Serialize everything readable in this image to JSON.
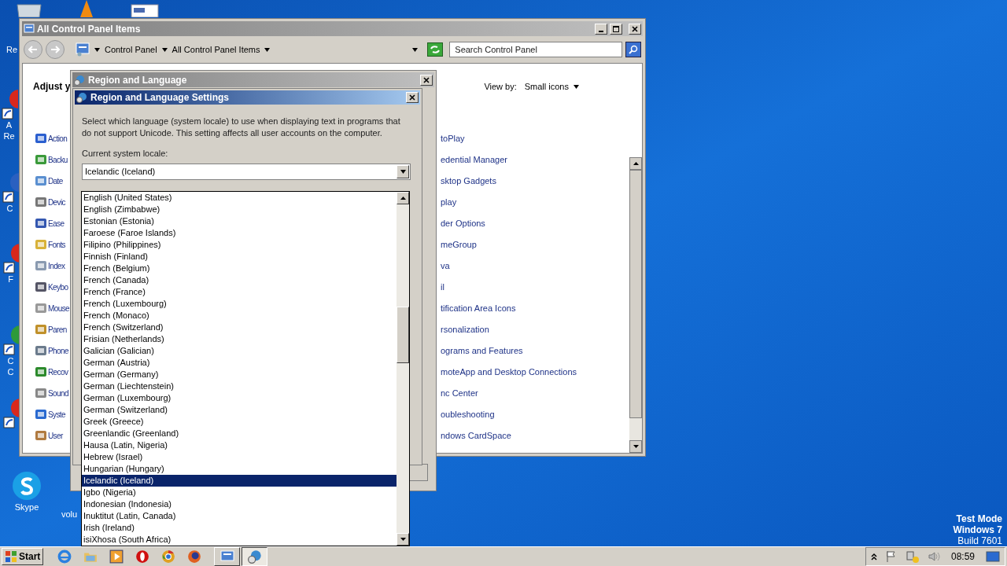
{
  "desktop": {
    "icons": [
      {
        "kind": "bin",
        "lines": [
          "Re"
        ]
      },
      {
        "kind": "cone"
      },
      {
        "kind": "doc"
      },
      {
        "kind": "red",
        "lines": [
          "A",
          "Re"
        ]
      },
      {
        "kind": "blue",
        "lines": [
          "C"
        ]
      },
      {
        "kind": "red",
        "lines": [
          "F"
        ]
      },
      {
        "kind": "green",
        "lines": [
          "C",
          "C"
        ]
      },
      {
        "kind": "red"
      },
      {
        "kind": "skype",
        "lines": [
          "Skype"
        ]
      },
      {
        "kind": "blank",
        "lines": [
          "volu"
        ]
      }
    ],
    "notice": [
      "Test Mode",
      "Windows 7",
      "Build 7601"
    ]
  },
  "control_panel": {
    "title": "All Control Panel Items",
    "breadcrumbs": [
      "Control Panel",
      "All Control Panel Items"
    ],
    "search": {
      "placeholder": "Search Control Panel"
    },
    "heading": "Adjust y",
    "view_by": {
      "label": "View by:",
      "value": "Small icons"
    },
    "left_items": [
      "Action",
      "Backu",
      "Date",
      "Devic",
      "Ease",
      "Fonts",
      "Index",
      "Keybo",
      "Mouse",
      "Paren",
      "Phone",
      "Recov",
      "Sound",
      "Syste",
      "User"
    ],
    "right_items": [
      "toPlay",
      "edential Manager",
      "sktop Gadgets",
      "play",
      "der Options",
      "meGroup",
      "va",
      "il",
      "tification Area Icons",
      "rsonalization",
      "ograms and Features",
      "moteApp and Desktop Connections",
      "nc Center",
      "oubleshooting",
      "ndows CardSpace"
    ]
  },
  "region_dialog": {
    "title": "Region and Language"
  },
  "settings_dialog": {
    "title": "Region and Language Settings",
    "description": "Select which language (system locale) to use when displaying text in programs that do not support Unicode. This setting affects all user accounts on the computer.",
    "locale_label": "Current system locale:",
    "locale_value": "Icelandic (Iceland)",
    "options": [
      {
        "label": "English (United States)",
        "selected": false
      },
      {
        "label": "English (Zimbabwe)",
        "selected": false
      },
      {
        "label": "Estonian (Estonia)",
        "selected": false
      },
      {
        "label": "Faroese (Faroe Islands)",
        "selected": false
      },
      {
        "label": "Filipino (Philippines)",
        "selected": false
      },
      {
        "label": "Finnish (Finland)",
        "selected": false
      },
      {
        "label": "French (Belgium)",
        "selected": false
      },
      {
        "label": "French (Canada)",
        "selected": false
      },
      {
        "label": "French (France)",
        "selected": false
      },
      {
        "label": "French (Luxembourg)",
        "selected": false
      },
      {
        "label": "French (Monaco)",
        "selected": false
      },
      {
        "label": "French (Switzerland)",
        "selected": false
      },
      {
        "label": "Frisian (Netherlands)",
        "selected": false
      },
      {
        "label": "Galician (Galician)",
        "selected": false
      },
      {
        "label": "German (Austria)",
        "selected": false
      },
      {
        "label": "German (Germany)",
        "selected": false
      },
      {
        "label": "German (Liechtenstein)",
        "selected": false
      },
      {
        "label": "German (Luxembourg)",
        "selected": false
      },
      {
        "label": "German (Switzerland)",
        "selected": false
      },
      {
        "label": "Greek (Greece)",
        "selected": false
      },
      {
        "label": "Greenlandic (Greenland)",
        "selected": false
      },
      {
        "label": "Hausa (Latin, Nigeria)",
        "selected": false
      },
      {
        "label": "Hebrew (Israel)",
        "selected": false
      },
      {
        "label": "Hungarian (Hungary)",
        "selected": false
      },
      {
        "label": "Icelandic (Iceland)",
        "selected": true
      },
      {
        "label": "Igbo (Nigeria)",
        "selected": false
      },
      {
        "label": "Indonesian (Indonesia)",
        "selected": false
      },
      {
        "label": "Inuktitut (Latin, Canada)",
        "selected": false
      },
      {
        "label": "Irish (Ireland)",
        "selected": false
      },
      {
        "label": "isiXhosa (South Africa)",
        "selected": false
      }
    ]
  },
  "taskbar": {
    "start": "Start",
    "quick_launch": [
      {
        "kind": "ie"
      },
      {
        "kind": "folder"
      },
      {
        "kind": "media"
      },
      {
        "kind": "opera"
      },
      {
        "kind": "chrome"
      },
      {
        "kind": "firefox"
      }
    ],
    "tasks": [
      {
        "kind": "control",
        "selected": false
      },
      {
        "kind": "globe",
        "selected": true
      }
    ],
    "clock": "08:59"
  }
}
